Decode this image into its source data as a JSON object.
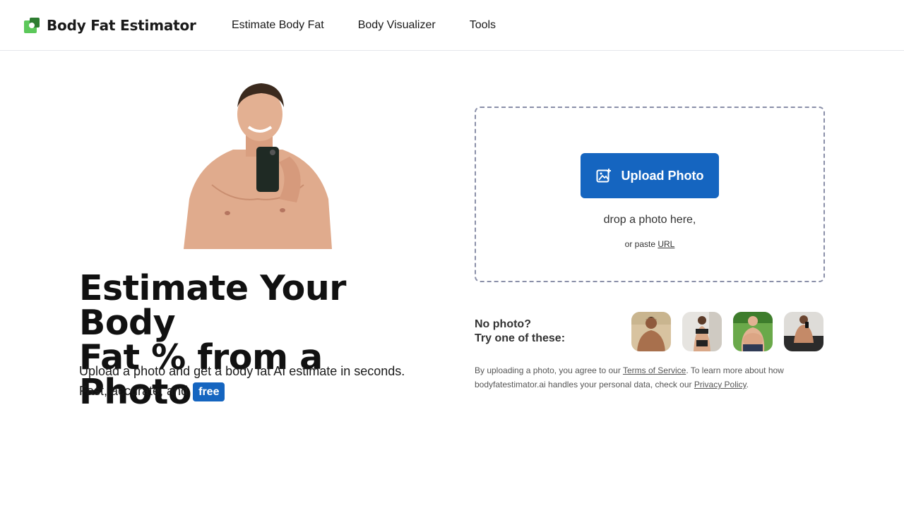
{
  "header": {
    "brand_name": "Body Fat Estimator",
    "logo_icon": "green-square-logo-icon",
    "nav": [
      {
        "label": "Estimate Body Fat"
      },
      {
        "label": "Body Visualizer"
      },
      {
        "label": "Tools"
      }
    ]
  },
  "hero": {
    "photo_icon": "shirtless-man-selfie-photo",
    "title_line1": "Estimate Your Body",
    "title_line2": "Fat % from a Photo",
    "subtitle_line1": "Upload a photo and get a body fat AI estimate in seconds.",
    "subtitle_line2": "Fast, accurate, and",
    "free_badge": "free"
  },
  "upload": {
    "button_label": "Upload Photo",
    "button_icon": "image-plus-icon",
    "drop_text": "drop a photo here,",
    "paste_prefix": "or paste",
    "paste_link": "URL"
  },
  "samples": {
    "label_line1": "No photo?",
    "label_line2": "Try one of these:",
    "items": [
      {
        "icon": "sample-photo-man-outdoors"
      },
      {
        "icon": "sample-photo-woman-mirror"
      },
      {
        "icon": "sample-photo-man-backyard"
      },
      {
        "icon": "sample-photo-man-gym"
      }
    ]
  },
  "legal": {
    "part1": "By uploading a photo, you agree to our",
    "tos_link": "Terms of Service",
    "part2": ". To learn more about how bodyfatestimator.ai handles your personal data, check our",
    "privacy_link": "Privacy Policy",
    "part3": "."
  },
  "colors": {
    "accent": "#1565c0",
    "logo_green": "#5cc85a",
    "dropzone_border": "#8a8fa8"
  }
}
